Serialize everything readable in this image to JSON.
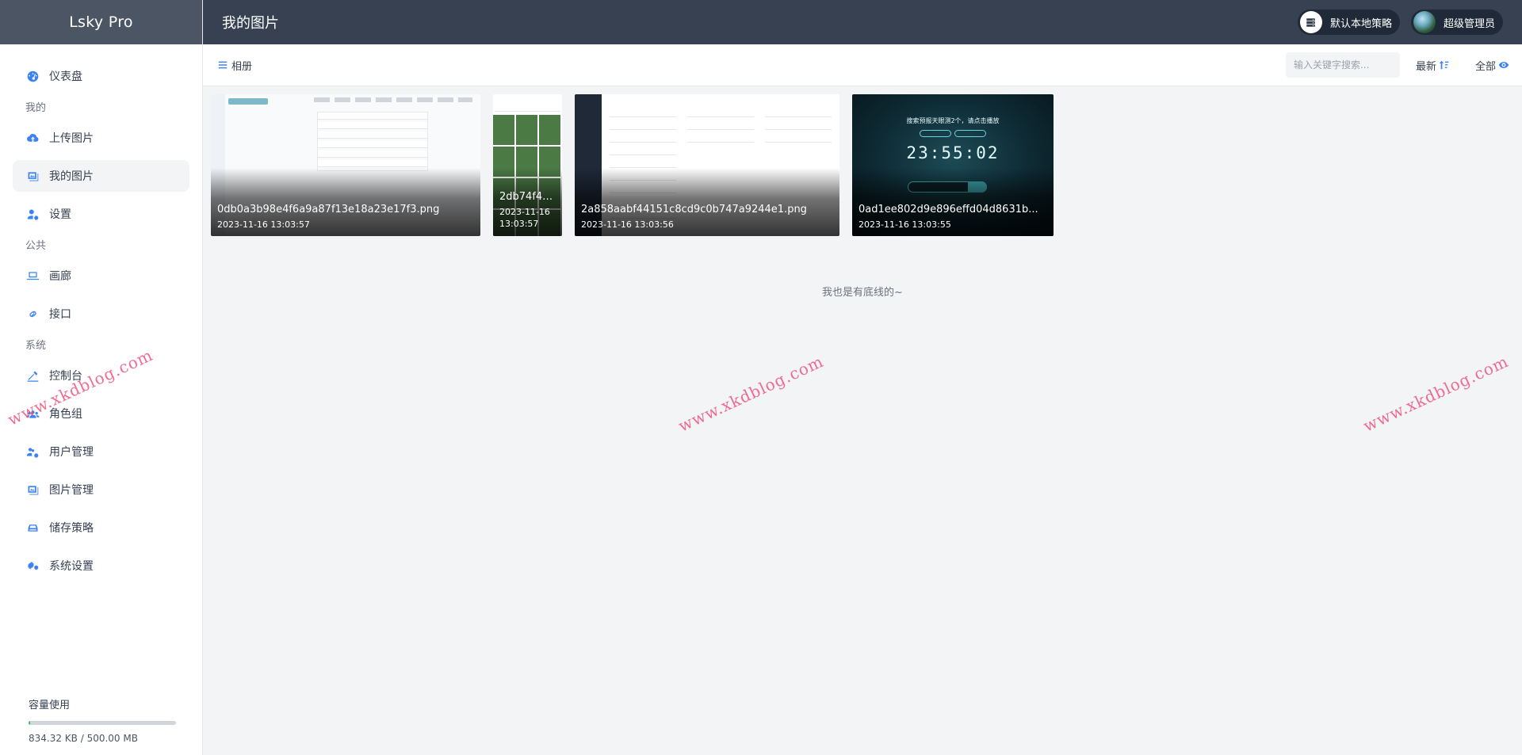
{
  "app": {
    "brand": "Lsky Pro"
  },
  "header": {
    "title": "我的图片",
    "strategy_label": "默认本地策略",
    "user_label": "超级管理员"
  },
  "sidebar": {
    "dashboard": "仪表盘",
    "group_mine": "我的",
    "upload": "上传图片",
    "my_images": "我的图片",
    "settings": "设置",
    "group_public": "公共",
    "gallery": "画廊",
    "api": "接口",
    "group_system": "系统",
    "console": "控制台",
    "roles": "角色组",
    "users": "用户管理",
    "images": "图片管理",
    "storage": "储存策略",
    "system_settings": "系统设置"
  },
  "usage": {
    "title": "容量使用",
    "text": "834.32 KB / 500.00 MB",
    "fraction": 0.0016
  },
  "toolbar": {
    "albums": "相册",
    "search_placeholder": "输入关键字搜索...",
    "sort_label": "最新",
    "visibility_label": "全部"
  },
  "images": [
    {
      "name": "0db0a3b98e4f6a9a87f13e18a23e17f3.png",
      "time": "2023-11-16 13:03:57"
    },
    {
      "name": "2db74f4e...",
      "time": "2023-11-16 13:03:57"
    },
    {
      "name": "2a858aabf44151c8cd9c0b747a9244e1.png",
      "time": "2023-11-16 13:03:56"
    },
    {
      "name": "0ad1ee802d9e896effd04d8631b...",
      "time": "2023-11-16 13:03:55"
    }
  ],
  "thumb4": {
    "headline": "搜索预报天眼测2个，请点击播放",
    "clock": "23:55:02"
  },
  "end_note": "我也是有底线的~",
  "watermark": "www.xkdblog.com",
  "colors": {
    "accent": "#3b82f6",
    "header_bg": "#374151",
    "brand_bg": "#4b5563",
    "usage_fill": "#22c55e"
  },
  "icons": [
    "dashboard-icon",
    "cloud-upload-icon",
    "images-icon",
    "user-gear-icon",
    "laptop-icon",
    "link-icon",
    "console-icon",
    "users-icon",
    "user-cog-icon",
    "image-manage-icon",
    "database-icon",
    "gears-icon",
    "server-icon",
    "list-icon",
    "sort-icon",
    "eye-icon"
  ]
}
